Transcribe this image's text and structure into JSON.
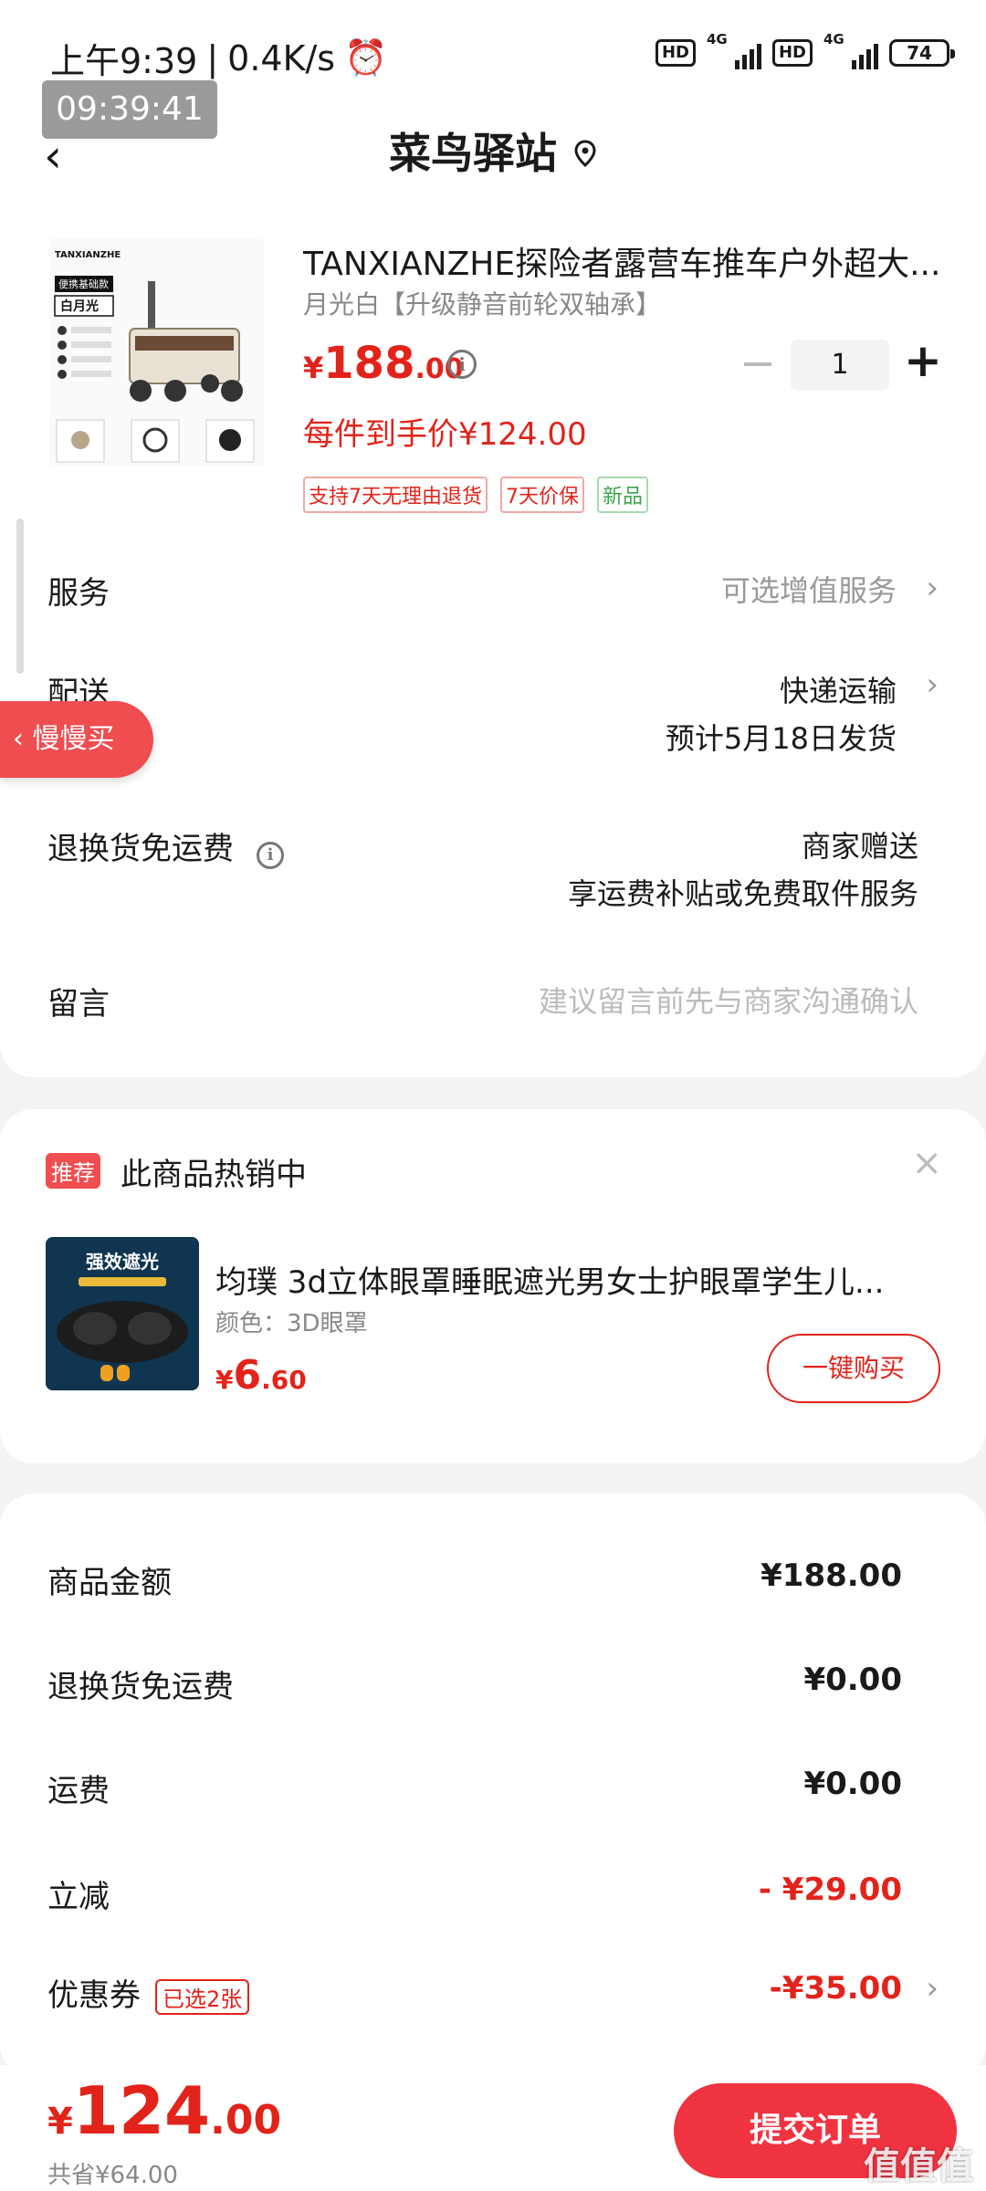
{
  "status_bar": {
    "time": "上午9:39",
    "speed": "0.4K/s",
    "network": "4G",
    "battery": "74",
    "clock_overlay": "09:39:41"
  },
  "header": {
    "title": "菜鸟驿站"
  },
  "product": {
    "name": "TANXIANZHE探险者露营车推车户外超大...",
    "spec": "月光白【升级静音前轮双轴承】",
    "price_symbol": "¥",
    "price_int": "188",
    "price_dec": ".00",
    "quantity": "1",
    "final_price": "每件到手价¥124.00",
    "tags": [
      "支持7天无理由退货",
      "7天价保",
      "新品"
    ],
    "thumb_brand": "TANXIANZHE",
    "thumb_badge1": "便携基础款",
    "thumb_badge2": "白月光"
  },
  "rows": {
    "service_label": "服务",
    "service_value": "可选增值服务",
    "delivery_label": "配送",
    "delivery_value": "快递运输",
    "delivery_date": "预计5月18日发货",
    "return_label": "退换货免运费",
    "return_value1": "商家赠送",
    "return_value2": "享运费补贴或免费取件服务",
    "message_label": "留言",
    "message_placeholder": "建议留言前先与商家沟通确认"
  },
  "slow_buy": "慢慢买",
  "recommend": {
    "tag": "推荐",
    "title": "此商品热销中",
    "name": "均璞 3d立体眼罩睡眠遮光男女士护眼罩学生儿...",
    "spec": "颜色：3D眼罩",
    "price_symbol": "¥",
    "price_int": "6",
    "price_dec": ".60",
    "buy_label": "一键购买",
    "img_text": "强效遮光"
  },
  "summary": [
    {
      "label": "商品金额",
      "value": "¥188.00"
    },
    {
      "label": "退换货免运费",
      "value": "¥0.00"
    },
    {
      "label": "运费",
      "value": "¥0.00"
    },
    {
      "label": "立减",
      "value": "- ¥29.00"
    },
    {
      "label": "优惠券",
      "value": "-¥35.00",
      "tag": "已选2张"
    }
  ],
  "bottom": {
    "symbol": "¥",
    "total_int": "124",
    "total_dec": ".00",
    "saved": "共省¥64.00",
    "submit_label": "提交订单",
    "watermark": "值值值"
  }
}
